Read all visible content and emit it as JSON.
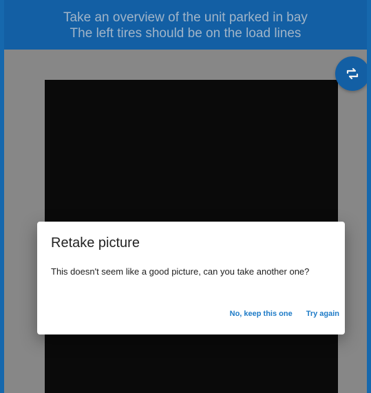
{
  "header": {
    "line1": "Take an overview of the unit parked in bay",
    "line2": "The left tires should be on the load lines"
  },
  "camera_switch": {
    "icon": "camera-switch-icon"
  },
  "dialog": {
    "title": "Retake picture",
    "message": "This doesn't seem like a good picture, can you take another one?",
    "keep_label": "No, keep this one",
    "retry_label": "Try again"
  },
  "colors": {
    "primary": "#1565ad",
    "action": "#1e7bc7",
    "preview": "#0b0b0b"
  }
}
